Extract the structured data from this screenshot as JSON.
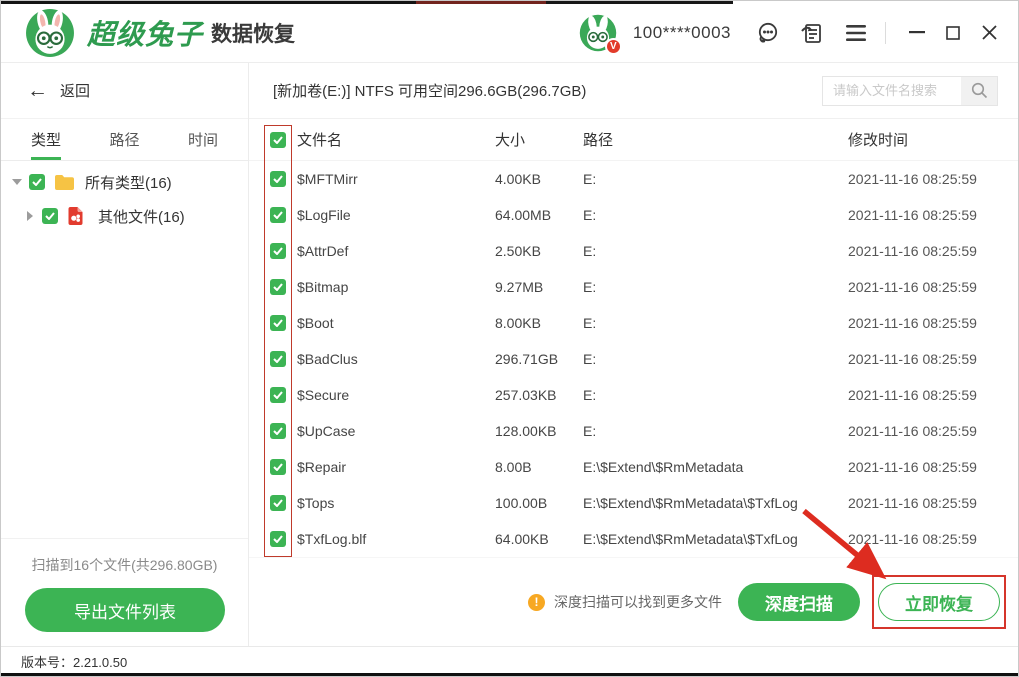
{
  "window": {
    "brand": "超级兔子",
    "product": "数据恢复",
    "account": "100****0003"
  },
  "icons": {
    "titlebar": [
      "customer-service-icon",
      "feedback-icon",
      "menu-icon",
      "minimize-icon",
      "maximize-icon",
      "close-icon"
    ],
    "search": "search-icon",
    "tree": [
      "folder-icon",
      "other-file-icon"
    ],
    "hint": "warning-icon"
  },
  "colors": {
    "primary_green": "#3cb454",
    "brand_green": "#2e9b4f",
    "annotation_red": "#d5352b",
    "warning_orange": "#f7a823",
    "folder_yellow": "#f6c344",
    "file_red": "#e23b2e"
  },
  "toolbar": {
    "drive_info": "[新加卷(E:)] NTFS 可用空间296.6GB(296.7GB)",
    "search_placeholder": "请输入文件名搜索"
  },
  "sidebar": {
    "back_label": "返回",
    "tabs": [
      {
        "label": "类型",
        "active": true
      },
      {
        "label": "路径",
        "active": false
      },
      {
        "label": "时间",
        "active": false
      }
    ],
    "tree": [
      {
        "label": "所有类型(16)",
        "icon": "folder-icon",
        "expanded": true,
        "checked": true
      },
      {
        "label": "其他文件(16)",
        "icon": "other-file-icon",
        "expanded": false,
        "checked": true
      }
    ],
    "scan_summary": "扫描到16个文件(共296.80GB)",
    "export_button": "导出文件列表"
  },
  "table": {
    "all_rows_checked": true,
    "headers": {
      "name": "文件名",
      "size": "大小",
      "path": "路径",
      "modified": "修改时间"
    },
    "rows": [
      {
        "name": "$MFTMirr",
        "size": "4.00KB",
        "path": "E:",
        "modified": "2021-11-16 08:25:59"
      },
      {
        "name": "$LogFile",
        "size": "64.00MB",
        "path": "E:",
        "modified": "2021-11-16 08:25:59"
      },
      {
        "name": "$AttrDef",
        "size": "2.50KB",
        "path": "E:",
        "modified": "2021-11-16 08:25:59"
      },
      {
        "name": "$Bitmap",
        "size": "9.27MB",
        "path": "E:",
        "modified": "2021-11-16 08:25:59"
      },
      {
        "name": "$Boot",
        "size": "8.00KB",
        "path": "E:",
        "modified": "2021-11-16 08:25:59"
      },
      {
        "name": "$BadClus",
        "size": "296.71GB",
        "path": "E:",
        "modified": "2021-11-16 08:25:59"
      },
      {
        "name": "$Secure",
        "size": "257.03KB",
        "path": "E:",
        "modified": "2021-11-16 08:25:59"
      },
      {
        "name": "$UpCase",
        "size": "128.00KB",
        "path": "E:",
        "modified": "2021-11-16 08:25:59"
      },
      {
        "name": "$Repair",
        "size": "8.00B",
        "path": "E:\\$Extend\\$RmMetadata",
        "modified": "2021-11-16 08:25:59"
      },
      {
        "name": "$Tops",
        "size": "100.00B",
        "path": "E:\\$Extend\\$RmMetadata\\$TxfLog",
        "modified": "2021-11-16 08:25:59"
      },
      {
        "name": "$TxfLog.blf",
        "size": "64.00KB",
        "path": "E:\\$Extend\\$RmMetadata\\$TxfLog",
        "modified": "2021-11-16 08:25:59"
      }
    ]
  },
  "action_bar": {
    "hint": "深度扫描可以找到更多文件",
    "deep_scan_button": "深度扫描",
    "recover_button": "立即恢复"
  },
  "statusbar": {
    "version_text": "版本号：2.21.0.50"
  }
}
